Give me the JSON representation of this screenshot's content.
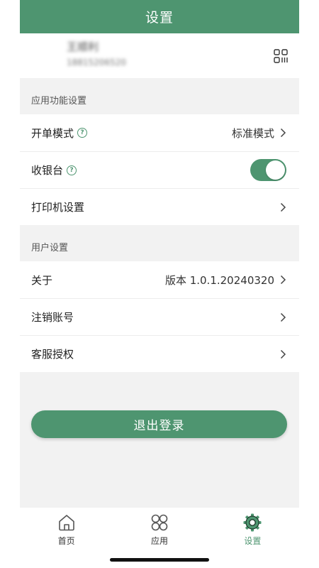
{
  "header": {
    "title": "设置"
  },
  "profile": {
    "name": "王顺利",
    "phone": "18815206520"
  },
  "sections": {
    "app": {
      "title": "应用功能设置",
      "rows": [
        {
          "label": "开单模式",
          "value": "标准模式"
        },
        {
          "label": "收银台",
          "toggle_on": true
        },
        {
          "label": "打印机设置"
        }
      ]
    },
    "user": {
      "title": "用户设置",
      "rows": [
        {
          "label": "关于",
          "value": "版本 1.0.1.20240320"
        },
        {
          "label": "注销账号"
        },
        {
          "label": "客服授权"
        }
      ]
    }
  },
  "logout": {
    "label": "退出登录"
  },
  "tabbar": [
    {
      "label": "首页",
      "icon": "home-icon"
    },
    {
      "label": "应用",
      "icon": "apps-icon"
    },
    {
      "label": "设置",
      "icon": "gear-icon",
      "active": true
    }
  ],
  "colors": {
    "brand": "#4e9570",
    "background": "#f2f2f2"
  }
}
